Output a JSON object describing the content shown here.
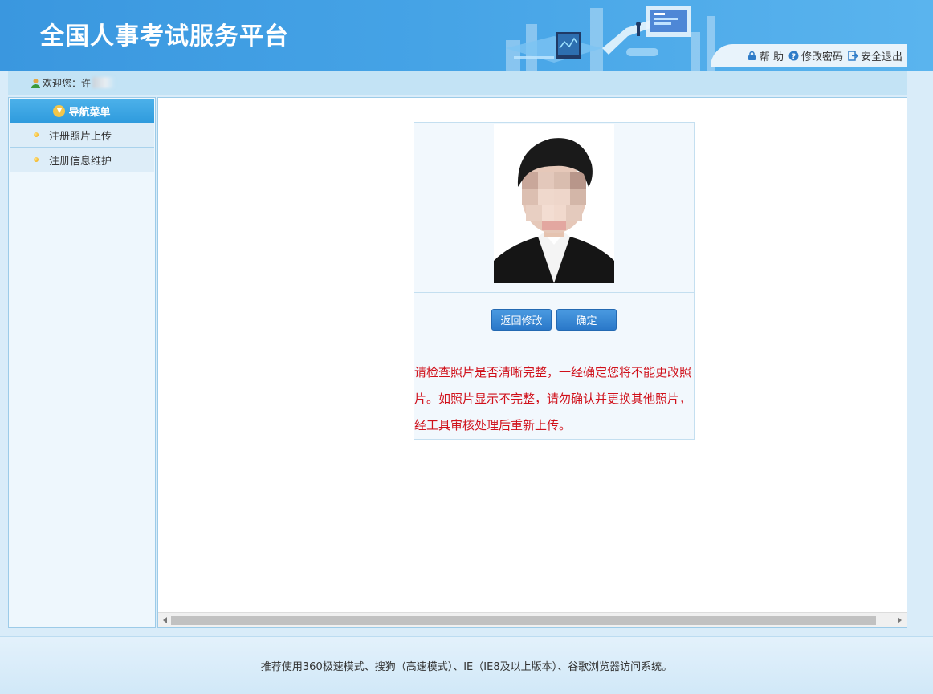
{
  "header": {
    "title": "全国人事考试服务平台",
    "links": {
      "help": "帮 助",
      "change_password": "修改密码",
      "logout": "安全退出"
    }
  },
  "welcome": {
    "label": "欢迎您：许"
  },
  "sidebar": {
    "heading": "导航菜单",
    "items": [
      {
        "label": "注册照片上传"
      },
      {
        "label": "注册信息维护"
      }
    ]
  },
  "main": {
    "buttons": {
      "back": "返回修改",
      "confirm": "确定"
    },
    "notice": "请检查照片是否清晰完整，一经确定您将不能更改照片。如照片显示不完整，请勿确认并更换其他照片，经工具审核处理后重新上传。"
  },
  "footer": {
    "text": "推荐使用360极速模式、搜狗（高速模式）、IE（IE8及以上版本）、谷歌浏览器访问系统。"
  },
  "colors": {
    "header_blue": "#3a97df",
    "nav_blue": "#2f9bdd",
    "button_blue": "#2a78c9",
    "notice_red": "#d0101a"
  }
}
